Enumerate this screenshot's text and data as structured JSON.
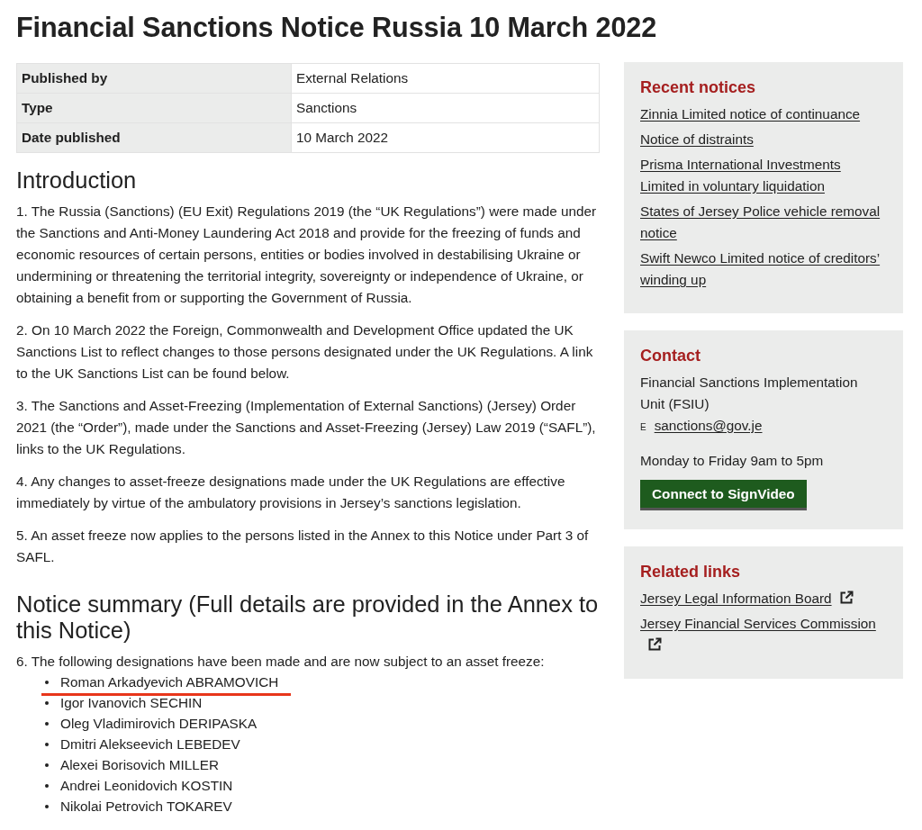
{
  "title": "Financial Sanctions Notice Russia 10 March 2022",
  "details_table": {
    "rows": [
      {
        "label": "Published by",
        "value": "External Relations"
      },
      {
        "label": "Type",
        "value": "Sanctions"
      },
      {
        "label": "Date published",
        "value": "10 March 2022"
      }
    ]
  },
  "sections": [
    {
      "heading": "Introduction",
      "paragraphs": [
        "1. The Russia (Sanctions) (EU Exit) Regulations 2019 (the “UK Regulations”) were made under the Sanctions and Anti-Money Laundering Act 2018 and provide for the freezing of funds and economic resources of certain persons, entities or bodies involved in destabilising Ukraine or undermining or threatening the territorial integrity, sovereignty or independence of Ukraine, or obtaining a benefit from or supporting the Government of Russia.",
        "2. On 10 March 2022 the Foreign, Commonwealth and Development Office updated the UK Sanctions List to reflect changes to those persons designated under the UK Regulations. A link to the UK Sanctions List can be found below.",
        "3. The Sanctions and Asset-Freezing (Implementation of External Sanctions) (Jersey) Order 2021 (the “Order”), made under the Sanctions and Asset-Freezing (Jersey) Law 2019 (“SAFL”), links to the UK Regulations.",
        "4. Any changes to asset-freeze designations made under the UK Regulations are effective immediately by virtue of the ambulatory provisions in Jersey’s sanctions legislation.",
        "5. An asset freeze now applies to the persons listed in the Annex to this Notice under Part 3 of SAFL."
      ]
    },
    {
      "heading": "Notice summary (Full details are provided in the Annex to this Notice)",
      "paragraphs": [
        "6. The following designations have been made and are now subject to an asset freeze:"
      ],
      "list": [
        {
          "name": "Roman Arkadyevich ABRAMOVICH",
          "highlighted": true
        },
        {
          "name": "Igor Ivanovich SECHIN",
          "highlighted": false
        },
        {
          "name": "Oleg Vladimirovich DERIPASKA",
          "highlighted": false
        },
        {
          "name": "Dmitri Alekseevich LEBEDEV",
          "highlighted": false
        },
        {
          "name": "Alexei Borisovich MILLER",
          "highlighted": false
        },
        {
          "name": "Andrei Leonidovich KOSTIN",
          "highlighted": false
        },
        {
          "name": "Nikolai Petrovich TOKAREV",
          "highlighted": false
        }
      ]
    }
  ],
  "sidebar": {
    "recent_notices": {
      "heading": "Recent notices",
      "links": [
        "Zinnia Limited notice of continuance",
        "Notice of distraints",
        "Prisma International Investments Limited in voluntary liquidation",
        "States of Jersey Police vehicle removal notice",
        "Swift Newco Limited notice of creditors’ winding up"
      ]
    },
    "contact": {
      "heading": "Contact",
      "unit": "Financial Sanctions Implementation Unit (FSIU)",
      "email_label": "E",
      "email": "sanctions@gov.je",
      "hours": "Monday to Friday 9am to 5pm",
      "button": "Connect to SignVideo"
    },
    "related_links": {
      "heading": "Related links",
      "links": [
        {
          "label": "Jersey Legal Information Board",
          "external": true
        },
        {
          "label": "Jersey Financial Services Commission",
          "external": true
        }
      ]
    }
  }
}
